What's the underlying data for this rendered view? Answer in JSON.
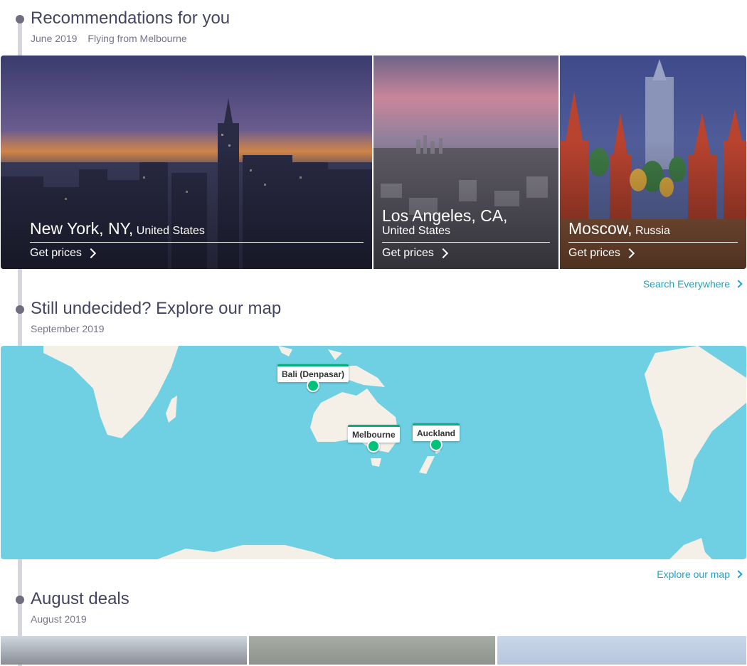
{
  "recommendations": {
    "title": "Recommendations for you",
    "date": "June 2019",
    "origin": "Flying from Melbourne",
    "cards": [
      {
        "city": "New York, NY,",
        "country": "United States",
        "cta": "Get prices"
      },
      {
        "city": "Los Angeles, CA,",
        "country": "United States",
        "cta": "Get prices"
      },
      {
        "city": "Moscow,",
        "country": "Russia",
        "cta": "Get prices"
      }
    ],
    "link": "Search Everywhere"
  },
  "explore": {
    "title": "Still undecided? Explore our map",
    "date": "September 2019",
    "pins": [
      {
        "name": "Bali (Denpasar)"
      },
      {
        "name": "Melbourne"
      },
      {
        "name": "Auckland"
      }
    ],
    "link": "Explore our map"
  },
  "deals": {
    "title": "August deals",
    "date": "August 2019"
  },
  "colors": {
    "accent": "#1fa3c5",
    "pin": "#00c27a",
    "ocean": "#6ed0e2",
    "land": "#f4f0e8"
  }
}
